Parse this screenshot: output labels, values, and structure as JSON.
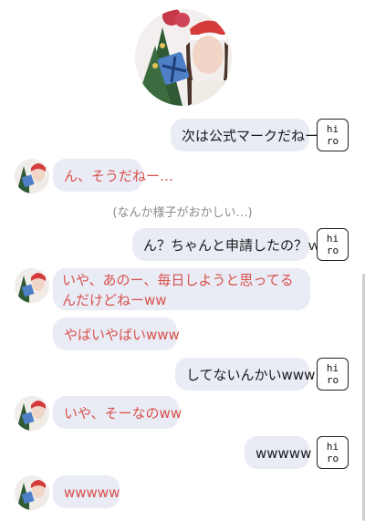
{
  "note": "(なんか様子がおかしい…)",
  "user_label": [
    "hi",
    "ro"
  ],
  "messages": [
    {
      "side": "right",
      "text": "次は公式マークだねー"
    },
    {
      "side": "left",
      "text": "ん、そうだねー…"
    },
    {
      "side": "right",
      "text": "ん？ちゃんと申請したの？ｗ"
    },
    {
      "side": "left",
      "text": "いや、あのー、毎日しようと思ってるんだけどねーww"
    },
    {
      "side": "left",
      "text": "やばいやばいwww"
    },
    {
      "side": "right",
      "text": "してないんかいwww"
    },
    {
      "side": "left",
      "text": "いや、そーなのww"
    },
    {
      "side": "right",
      "text": "wwwww"
    },
    {
      "side": "left",
      "text": "wwwww"
    }
  ],
  "colors": {
    "bubble_bg": "#e9ebf5",
    "left_text": "#d9514c",
    "right_text": "#1c1c1c"
  }
}
